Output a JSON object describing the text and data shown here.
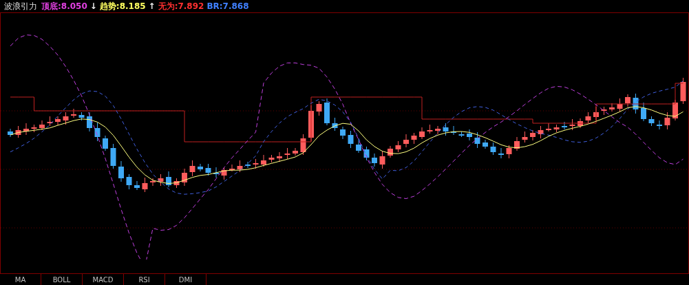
{
  "header": {
    "title": "波浪引力",
    "readings": [
      {
        "text": "顶底:8.050",
        "color": "#e040e0"
      },
      {
        "text": "↓"
      },
      {
        "text": "趋势:8.185",
        "color": "#ffff60"
      },
      {
        "text": "↑"
      },
      {
        "text": "无为:7.892",
        "color": "#ff3030"
      },
      {
        "text": "BR:7.868",
        "color": "#4080ff"
      }
    ]
  },
  "tabs": [
    {
      "label": "MA",
      "selected": false
    },
    {
      "label": "BOLL",
      "selected": false
    },
    {
      "label": "MACD",
      "selected": false
    },
    {
      "label": "RSI",
      "selected": false
    },
    {
      "label": "DMI",
      "selected": false
    }
  ]
}
